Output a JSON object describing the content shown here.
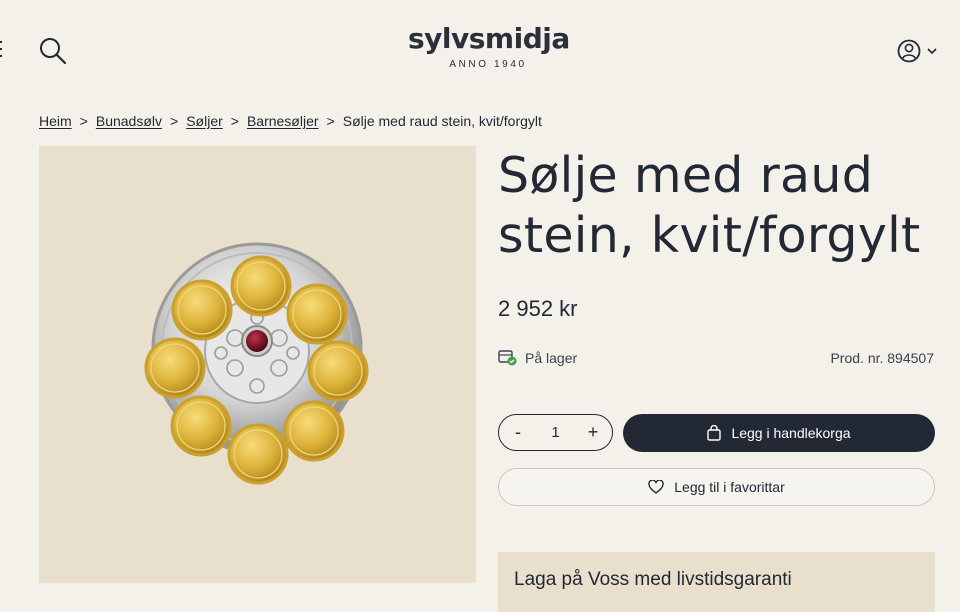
{
  "header": {
    "logo_name": "sylvsmidja",
    "logo_tagline": "ANNO 1940",
    "search_icon": "search-icon",
    "account_icon": "user-icon"
  },
  "breadcrumb": {
    "items": [
      "Heim",
      "Bunadsølv",
      "Søljer",
      "Barnesøljer"
    ],
    "current": "Sølje med raud stein, kvit/forgylt",
    "separator": ">"
  },
  "product": {
    "title": "Sølje med raud stein, kvit/forgylt",
    "price": "2 952 kr",
    "stock_label": "På lager",
    "product_number": "Prod. nr. 894507",
    "quantity": "1",
    "decrement_label": "-",
    "increment_label": "+",
    "add_to_cart_label": "Legg i handlekorga",
    "favorite_label": "Legg til i favorittar",
    "banner_text": "Laga på Voss med livstidsgaranti"
  },
  "colors": {
    "background": "#f3f1ea",
    "text": "#222834",
    "image_bg": "#e8e0cc",
    "stock_ok": "#3aa04a",
    "gold": "#d9b13c",
    "stone": "#7a1020"
  }
}
